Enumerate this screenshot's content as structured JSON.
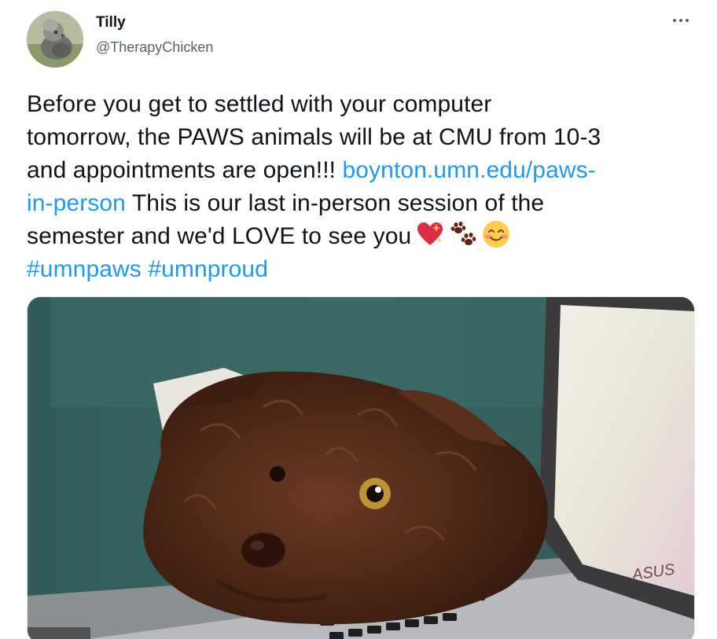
{
  "author": {
    "name": "Tilly",
    "handle": "@TherapyChicken",
    "avatar_icon": "chicken-avatar-icon"
  },
  "menu": {
    "icon": "more-options-icon"
  },
  "tweet": {
    "line1": "Before you get to settled with your computer",
    "line2": "tomorrow, the PAWS animals will be at CMU from 10-3",
    "line3_text": "and appointments are open!!! ",
    "line3_link": "boynton.umn.edu/paws-",
    "line4_link": "in-person",
    "line4_text": " This is our last in-person session of the",
    "line5_text": "semester and we'd LOVE to see you",
    "hashtags": "#umnpaws #umnproud",
    "emojis": [
      "sparkling-heart-emoji",
      "paw-prints-emoji",
      "smiling-face-emoji"
    ],
    "link_color": "#1d9bf0"
  },
  "media": {
    "description_icon": "dog-on-laptop-photo",
    "laptop_brand": "ASUS"
  }
}
